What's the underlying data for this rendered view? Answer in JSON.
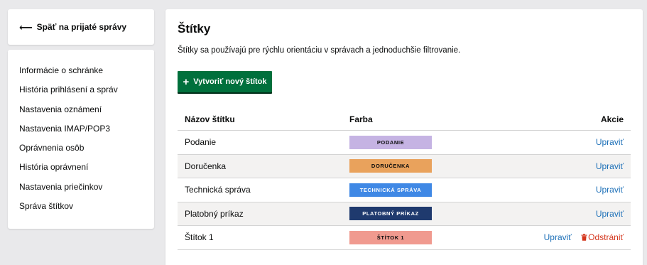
{
  "back_link": {
    "icon": "arrow-left-icon",
    "label": "Späť na prijaté správy"
  },
  "sidebar": {
    "items": [
      {
        "label": "Informácie o schránke"
      },
      {
        "label": "História prihlásení a správ"
      },
      {
        "label": "Nastavenia oznámení"
      },
      {
        "label": "Nastavenia IMAP/POP3"
      },
      {
        "label": "Oprávnenia osôb"
      },
      {
        "label": "História oprávnení"
      },
      {
        "label": "Nastavenia priečinkov"
      },
      {
        "label": "Správa štítkov"
      }
    ]
  },
  "main": {
    "title": "Štítky",
    "description": "Štítky sa používajú pre rýchlu orientáciu v správach a jednoduchšie filtrovanie.",
    "create_button": {
      "icon": "plus-icon",
      "label": "Vytvoriť nový štítok",
      "color": "#00703c"
    }
  },
  "table": {
    "headers": {
      "name": "Názov štítku",
      "color": "Farba",
      "actions": "Akcie"
    },
    "rows": [
      {
        "name": "Podanie",
        "badge": "PODANIE",
        "bg": "#c5b3e3",
        "fg": "#0b0c0c",
        "edit": "Upraviť"
      },
      {
        "name": "Doručenka",
        "badge": "DORUČENKA",
        "bg": "#e9a25c",
        "fg": "#0b0c0c",
        "edit": "Upraviť"
      },
      {
        "name": "Technická správa",
        "badge": "TECHNICKÁ SPRÁVA",
        "bg": "#3f88e5",
        "fg": "#ffffff",
        "edit": "Upraviť"
      },
      {
        "name": "Platobný príkaz",
        "badge": "PLATOBNÝ PRÍKAZ",
        "bg": "#1f3a6e",
        "fg": "#ffffff",
        "edit": "Upraviť"
      },
      {
        "name": "Štítok 1",
        "badge": "ŠTÍTOK 1",
        "bg": "#f09a8f",
        "fg": "#0b0c0c",
        "edit": "Upraviť",
        "delete": "Odstrániť",
        "delete_icon": "trash-icon"
      }
    ]
  },
  "colors": {
    "link": "#1d70b8",
    "danger": "#d4351c"
  }
}
